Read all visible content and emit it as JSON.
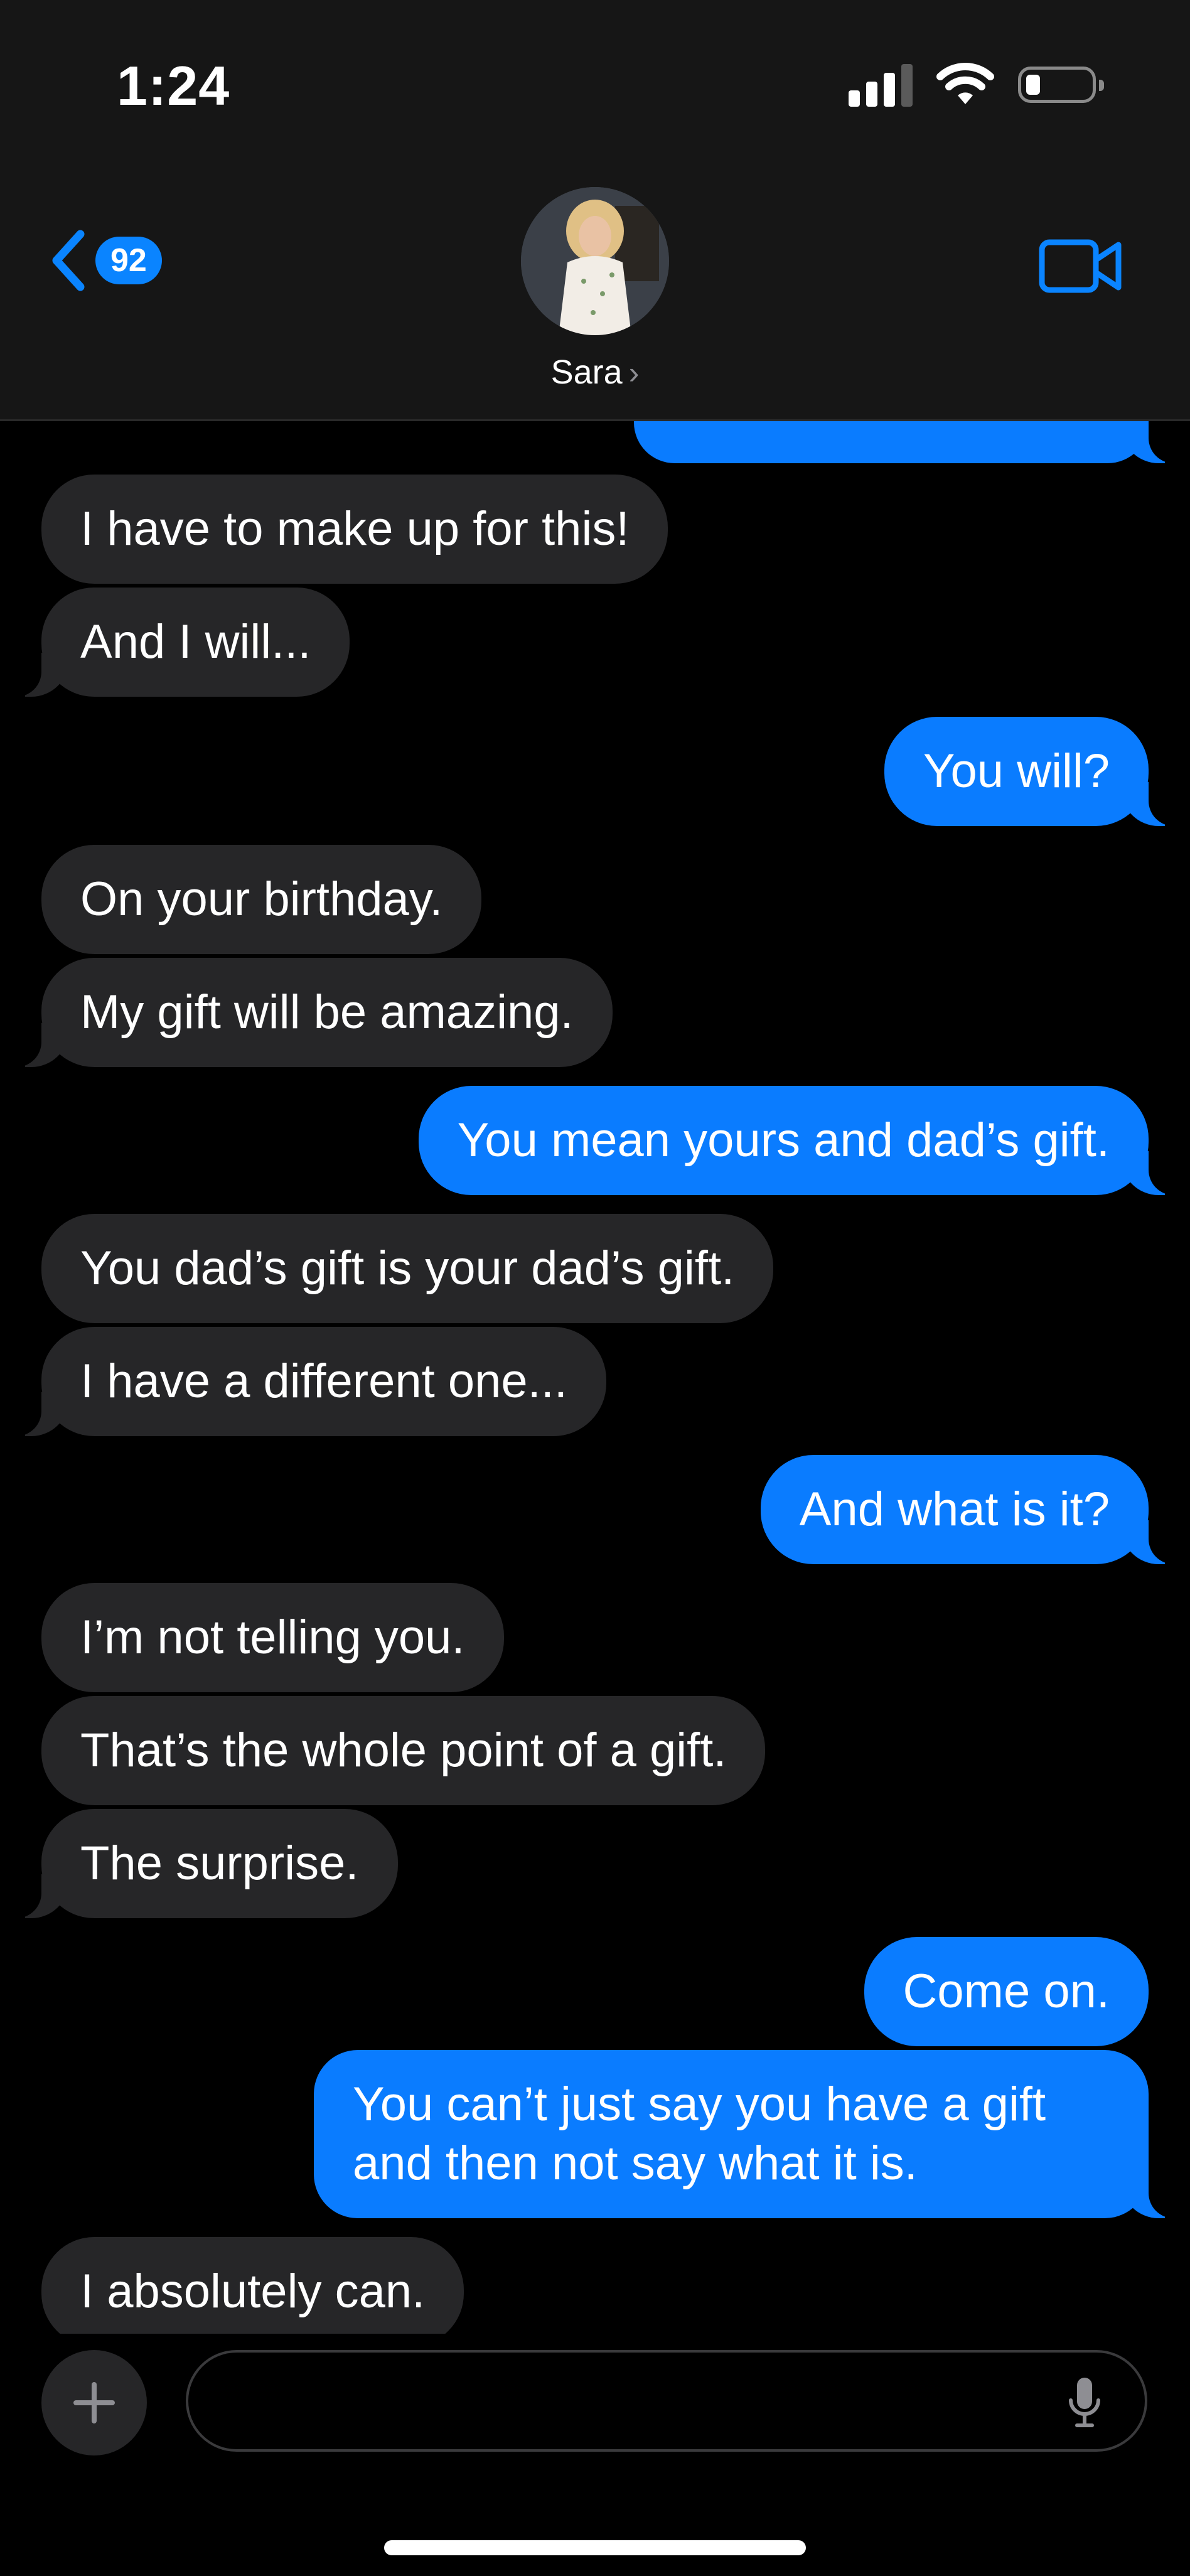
{
  "status_bar": {
    "time": "1:24"
  },
  "header": {
    "back_badge": "92",
    "contact_name": "Sara",
    "contact_chevron": "›"
  },
  "messages": [
    {
      "side": "out",
      "text": ""
    },
    {
      "side": "in",
      "text": "I have to make up for this!"
    },
    {
      "side": "in",
      "text": "And I will..."
    },
    {
      "side": "out",
      "text": "You will?"
    },
    {
      "side": "in",
      "text": "On your birthday."
    },
    {
      "side": "in",
      "text": "My gift will be amazing."
    },
    {
      "side": "out",
      "text": "You mean yours and dad’s gift."
    },
    {
      "side": "in",
      "text": "You dad’s gift is your dad’s gift."
    },
    {
      "side": "in",
      "text": "I have a different one..."
    },
    {
      "side": "out",
      "text": "And what is it?"
    },
    {
      "side": "in",
      "text": "I’m not telling you."
    },
    {
      "side": "in",
      "text": "That’s the whole point of a gift."
    },
    {
      "side": "in",
      "text": "The surprise."
    },
    {
      "side": "out",
      "text": "Come on."
    },
    {
      "side": "out",
      "text": "You can’t just say you have a gift and then not say what it is."
    },
    {
      "side": "in",
      "text": "I absolutely can."
    }
  ],
  "composer": {
    "placeholder": ""
  },
  "colors": {
    "outgoing_bubble": "#0a7cff",
    "incoming_bubble": "#262628",
    "accent": "#0a84ff",
    "background": "#000000"
  },
  "icons": [
    "back-chevron-icon",
    "video-camera-icon",
    "plus-icon",
    "microphone-icon",
    "wifi-icon",
    "cellular-signal-icon",
    "battery-icon"
  ]
}
